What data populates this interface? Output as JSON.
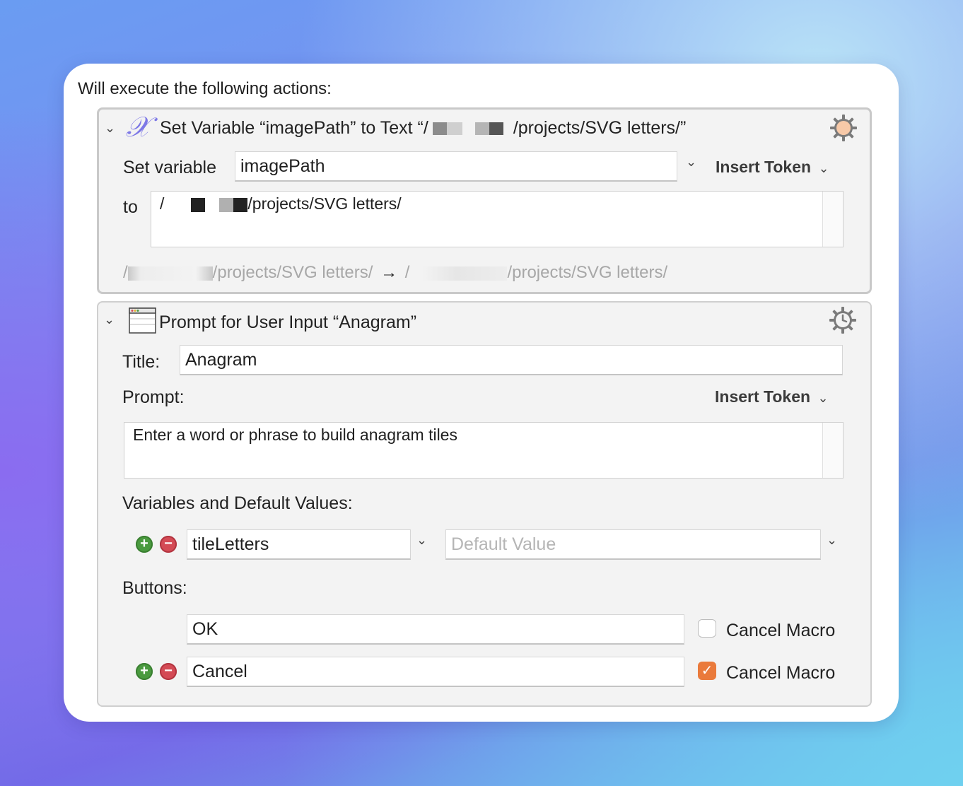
{
  "heading": "Will execute the following actions:",
  "action1": {
    "title_prefix": "Set Variable “imagePath” to Text “/",
    "title_suffix": "/projects/SVG letters/”",
    "set_variable_label": "Set variable",
    "variable_name": "imagePath",
    "insert_token_label": "Insert Token",
    "to_label": "to",
    "text_prefix": "/",
    "text_suffix": "/projects/SVG letters/",
    "preview_left": "/projects/SVG letters/",
    "preview_arrow": "→",
    "preview_right": "/projects/SVG letters/",
    "icon_glyph": "𝒳",
    "icon": "variable-x-icon",
    "gear_icon": "gear-orange-icon"
  },
  "action2": {
    "title": "Prompt for User Input “Anagram”",
    "title_label": "Title:",
    "title_value": "Anagram",
    "prompt_label": "Prompt:",
    "insert_token_label": "Insert Token",
    "prompt_text": "Enter a word or phrase to build anagram tiles",
    "variables_label": "Variables and Default Values:",
    "variable_name": "tileLetters",
    "default_value_placeholder": "Default Value",
    "buttons_label": "Buttons:",
    "buttons": [
      {
        "label": "OK",
        "cancel_macro_label": "Cancel Macro",
        "cancel_macro": false
      },
      {
        "label": "Cancel",
        "cancel_macro_label": "Cancel Macro",
        "cancel_macro": true
      }
    ],
    "icon": "window-icon",
    "gear_icon": "gear-clock-icon"
  },
  "colors": {
    "checkbox_checked": "#ea7a3b",
    "plus_button": "#4a9a3f",
    "minus_button": "#d44a55"
  }
}
